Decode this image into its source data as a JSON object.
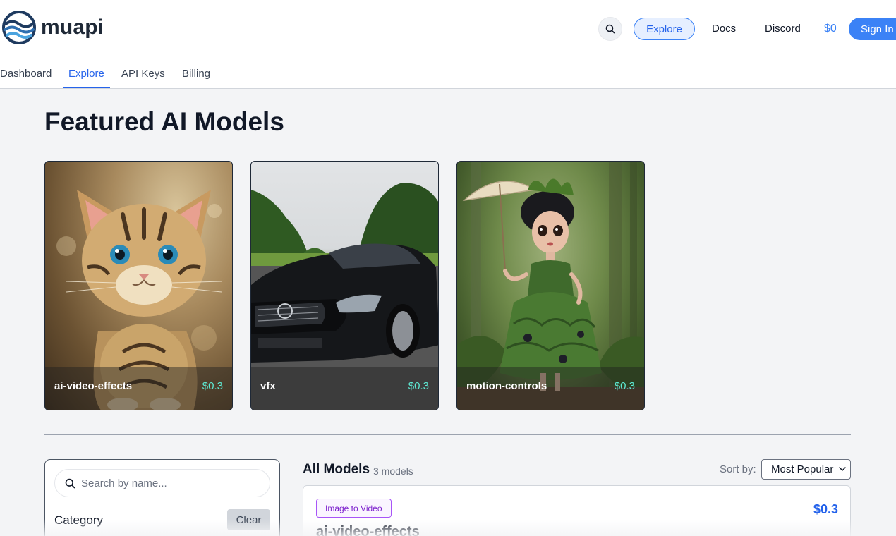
{
  "header": {
    "brand": "muapi",
    "nav": {
      "explore": "Explore",
      "docs": "Docs",
      "discord": "Discord",
      "balance": "$0",
      "sign_in": "Sign In"
    }
  },
  "subnav": {
    "tabs": [
      {
        "label": "Dashboard",
        "active": false
      },
      {
        "label": "Explore",
        "active": true
      },
      {
        "label": "API Keys",
        "active": false
      },
      {
        "label": "Billing",
        "active": false
      }
    ]
  },
  "main": {
    "title": "Featured AI Models",
    "featured": [
      {
        "name": "ai-video-effects",
        "price": "$0.3"
      },
      {
        "name": "vfx",
        "price": "$0.3"
      },
      {
        "name": "motion-controls",
        "price": "$0.3"
      }
    ]
  },
  "filters": {
    "search_placeholder": "Search by name...",
    "category_label": "Category",
    "clear_label": "Clear"
  },
  "models": {
    "title": "All Models",
    "count": "3 models",
    "sort_label": "Sort by:",
    "sort_selected": "Most Popular",
    "items": [
      {
        "tag": "Image to Video",
        "price": "$0.3",
        "name": "ai-video-effects"
      }
    ]
  },
  "colors": {
    "accent": "#3b82f6",
    "price_teal": "#5eead4",
    "badge_purple": "#a855f7"
  }
}
